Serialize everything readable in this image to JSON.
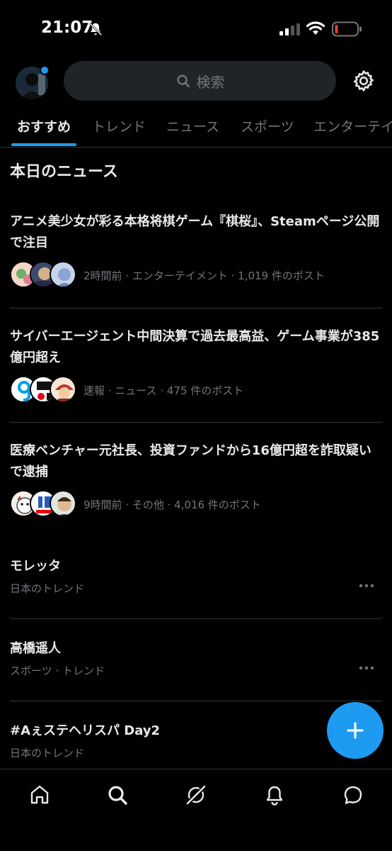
{
  "status_bar": {
    "time": "21:07"
  },
  "header": {
    "search_placeholder": "検索"
  },
  "tabs": [
    {
      "label": "おすすめ",
      "active": true
    },
    {
      "label": "トレンド"
    },
    {
      "label": "ニュース"
    },
    {
      "label": "スポーツ"
    },
    {
      "label": "エンターテイ"
    }
  ],
  "section_title": "本日のニュース",
  "news": [
    {
      "headline": "アニメ美少女が彩る本格将棋ゲーム『棋桜』、Steamページ公開で注目",
      "meta": "2時間前 · エンターテイメント · 1,019 件のポスト"
    },
    {
      "headline": "サイバーエージェント中間決算で過去最高益、ゲーム事業が385億円超え",
      "meta": "速報 · ニュース · 475 件のポスト"
    },
    {
      "headline": "医療ベンチャー元社長、投資ファンドから16億円超を詐取疑いで逮捕",
      "meta": "9時間前 · その他 · 4,016 件のポスト"
    }
  ],
  "trends": [
    {
      "title": "モレッタ",
      "subtitle": "日本のトレンド"
    },
    {
      "title": "高橋遥人",
      "subtitle": "スポーツ · トレンド"
    },
    {
      "title": "#Aぇステヘリスパ Day2",
      "subtitle": "日本のトレンド"
    }
  ],
  "colors": {
    "accent": "#1d9bf0",
    "background": "#000000",
    "secondary_text": "#71767b",
    "divider": "#2f3336"
  },
  "icons": [
    "bell-off-icon",
    "signal-icon",
    "wifi-icon",
    "battery-icon",
    "search-icon",
    "gear-icon",
    "more-icon",
    "plus-icon",
    "home-icon",
    "explore-icon",
    "grok-icon",
    "notifications-icon",
    "messages-icon"
  ]
}
